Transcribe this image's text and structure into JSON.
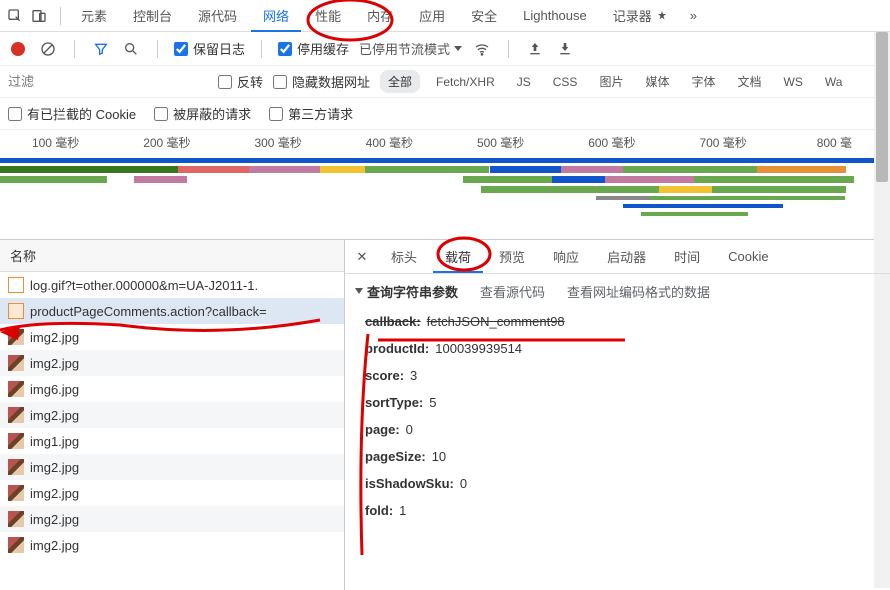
{
  "mainTabs": {
    "elements": "元素",
    "console": "控制台",
    "sources": "源代码",
    "network": "网络",
    "performance": "性能",
    "memory": "内存",
    "application": "应用",
    "security": "安全",
    "lighthouse": "Lighthouse",
    "recorder": "记录器"
  },
  "toolbar": {
    "preserveLog": "保留日志",
    "disableCache": "停用缓存",
    "throttling": "已停用节流模式"
  },
  "filterRow": {
    "placeholder": "过滤",
    "invert": "反转",
    "hideDataUrls": "隐藏数据网址",
    "all": "全部",
    "fetchXhr": "Fetch/XHR",
    "js": "JS",
    "css": "CSS",
    "img": "图片",
    "media": "媒体",
    "font": "字体",
    "doc": "文档",
    "ws": "WS",
    "wasm": "Wa"
  },
  "cookiesRow": {
    "blockedCookies": "有已拦截的 Cookie",
    "blockedRequests": "被屏蔽的请求",
    "thirdParty": "第三方请求"
  },
  "timeline": {
    "ticks": [
      "100 毫秒",
      "200 毫秒",
      "300 毫秒",
      "400 毫秒",
      "500 毫秒",
      "600 毫秒",
      "700 毫秒",
      "800 毫"
    ]
  },
  "leftPane": {
    "header": "名称",
    "rows": [
      {
        "icon": "doc",
        "name": "log.gif?t=other.000000&m=UA-J2011-1."
      },
      {
        "icon": "xhr",
        "name": "productPageComments.action?callback=",
        "sel": true
      },
      {
        "icon": "img",
        "name": "img2.jpg"
      },
      {
        "icon": "img",
        "name": "img2.jpg"
      },
      {
        "icon": "img",
        "name": "img6.jpg"
      },
      {
        "icon": "img",
        "name": "img2.jpg"
      },
      {
        "icon": "img",
        "name": "img1.jpg"
      },
      {
        "icon": "img",
        "name": "img2.jpg"
      },
      {
        "icon": "img",
        "name": "img2.jpg"
      },
      {
        "icon": "img",
        "name": "img2.jpg"
      },
      {
        "icon": "img",
        "name": "img2.jpg"
      }
    ]
  },
  "detailTabs": {
    "headers": "标头",
    "payload": "载荷",
    "preview": "预览",
    "response": "响应",
    "initiator": "启动器",
    "timing": "时间",
    "cookies": "Cookie"
  },
  "payload": {
    "sectionTitle": "查询字符串参数",
    "viewSource": "查看源代码",
    "viewUrlEncoded": "查看网址编码格式的数据",
    "params": [
      {
        "k": "callback:",
        "v": "fetchJSON_comment98",
        "struck": true
      },
      {
        "k": "productId:",
        "v": "100039939514"
      },
      {
        "k": "score:",
        "v": "3"
      },
      {
        "k": "sortType:",
        "v": "5"
      },
      {
        "k": "page:",
        "v": "0"
      },
      {
        "k": "pageSize:",
        "v": "10"
      },
      {
        "k": "isShadowSku:",
        "v": "0"
      },
      {
        "k": "fold:",
        "v": "1"
      }
    ]
  }
}
